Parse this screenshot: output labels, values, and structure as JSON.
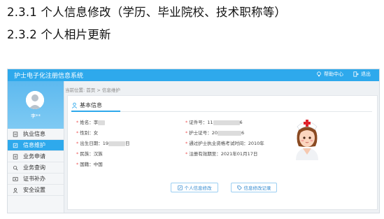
{
  "doc": {
    "heading1": "2.3.1  个人信息修改（学历、毕业院校、技术职称等）",
    "heading2": "2.3.2  个人相片更新"
  },
  "app": {
    "title": "护士电子化注册信息系统",
    "help_label": "帮助中心",
    "logout_label": "退出",
    "accent_color": "#2ea9ec"
  },
  "sidebar": {
    "username": "李**",
    "items": [
      {
        "label": "执业信息",
        "icon": "license-icon",
        "active": false
      },
      {
        "label": "信息维护",
        "icon": "edit-info-icon",
        "active": true
      },
      {
        "label": "业务申请",
        "icon": "apply-icon",
        "active": false
      },
      {
        "label": "业务查询",
        "icon": "query-icon",
        "active": false
      },
      {
        "label": "证书补办",
        "icon": "certificate-icon",
        "active": false
      },
      {
        "label": "安全设置",
        "icon": "security-icon",
        "active": false
      }
    ]
  },
  "breadcrumb": "当前位置: 首页 > 信息维护",
  "panel": {
    "section_title": "基本信息",
    "fields": {
      "name": {
        "label": "姓名：",
        "value": "李"
      },
      "gender": {
        "label": "性别：",
        "value": "女"
      },
      "birth": {
        "label": "出生日期：",
        "prefix": "19",
        "suffix": "日"
      },
      "ethnicity": {
        "label": "民族：",
        "value": "汉族"
      },
      "nationality": {
        "label": "国籍：",
        "value": "中国"
      },
      "id_no": {
        "label": "证件号：",
        "prefix": "11",
        "suffix": "6"
      },
      "nurse_cert": {
        "label": "护士证号：",
        "prefix": "20",
        "suffix": "6"
      },
      "exam": {
        "label": "通过护士执业资格考试时间：",
        "value": "2010年"
      },
      "validity": {
        "label": "注册有效期至：",
        "value": "2021年01月17日"
      }
    },
    "buttons": {
      "edit": "个人信息修改",
      "records": "信息修改记录"
    }
  }
}
